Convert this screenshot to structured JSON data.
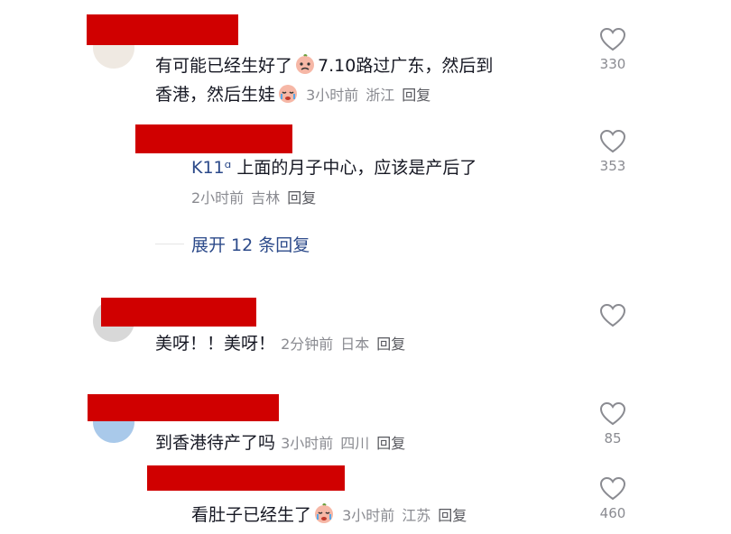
{
  "comments": [
    {
      "text_before": "有可能已经生好了",
      "text_after": "7.10路过广东，然后到",
      "line2": "香港，然后生娃",
      "time": "3小时前",
      "location": "浙江",
      "reply": "回复",
      "likes": "330"
    },
    {
      "tag": "K11ᵅ",
      "text": "上面的月子中心，应该是产后了",
      "time": "2小时前",
      "location": "吉林",
      "reply": "回复",
      "likes": "353",
      "expand": "展开 12 条回复"
    },
    {
      "text": "美呀！！美呀！",
      "time": "2分钟前",
      "location": "日本",
      "reply": "回复",
      "likes": ""
    },
    {
      "text": "到香港待产了吗",
      "time": "3小时前",
      "location": "四川",
      "reply": "回复",
      "likes": "85"
    },
    {
      "text": "看肚子已经生了",
      "time": "3小时前",
      "location": "江苏",
      "reply": "回复",
      "likes": "460"
    }
  ],
  "icons": {
    "like": "heart-outline-icon",
    "emoji": "crying-face-emoji"
  },
  "colors": {
    "redaction": "#d00000",
    "meta": "#8a8b91",
    "link": "#2c4a8a"
  }
}
